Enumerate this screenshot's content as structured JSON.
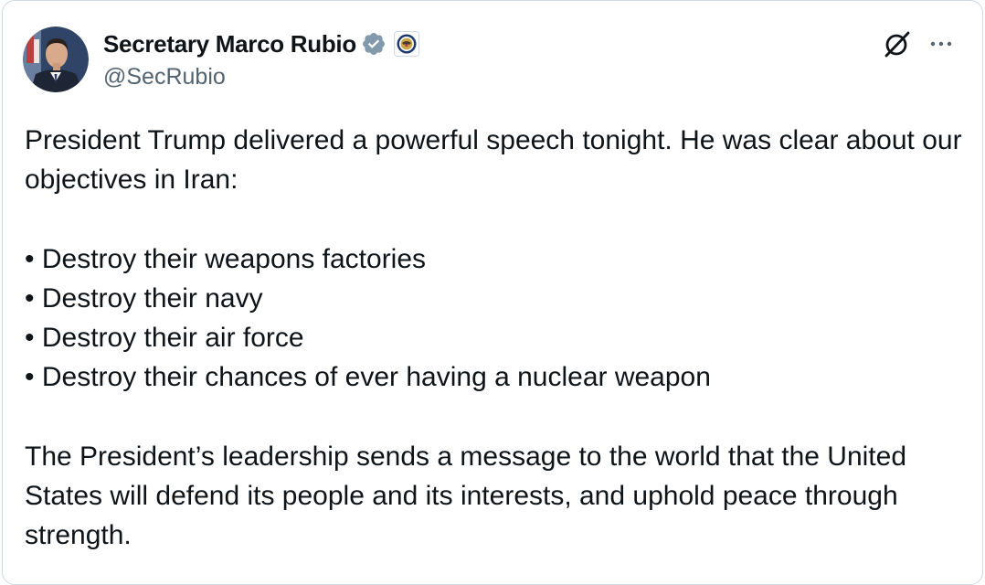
{
  "post": {
    "author": {
      "display_name": "Secretary Marco Rubio",
      "handle": "@SecRubio",
      "verified_icon": "verified-badge-icon",
      "affiliation_icon": "state-department-seal-icon"
    },
    "actions": {
      "grok_icon": "grok-icon",
      "more_icon": "more-options-icon"
    },
    "text": {
      "intro": "President Trump delivered a powerful speech tonight. He was clear about our objectives in Iran:",
      "bullets": [
        "• Destroy their weapons factories",
        "• Destroy their navy",
        "• Destroy their air force",
        "• Destroy their chances of ever having a nuclear weapon"
      ],
      "closing": "The President’s leadership sends a message to the world that the United States will defend its people and its interests, and uphold peace through strength."
    }
  },
  "colors": {
    "text": "#0f1419",
    "secondary": "#536471",
    "verified_badge": "#829aab",
    "border": "#cfd9de"
  }
}
